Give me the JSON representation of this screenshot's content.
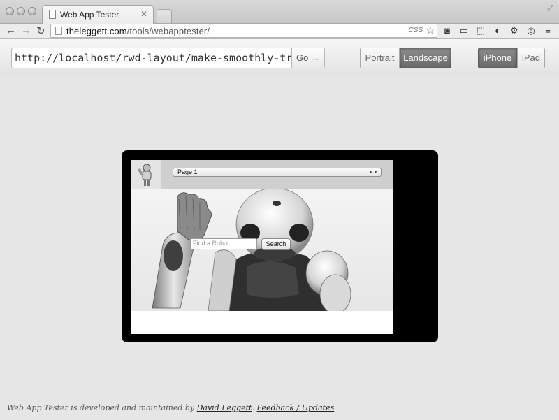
{
  "browser": {
    "tab_title": "Web App Tester",
    "address_domain": "theleggett.com",
    "address_path": "/tools/webapptester/",
    "css_indicator": "CSS"
  },
  "app": {
    "url_value": "http://localhost/rwd-layout/make-smoothly-transitioning",
    "go_label": "Go →",
    "orientation_options": [
      "Portrait",
      "Landscape"
    ],
    "orientation_selected": "Landscape",
    "device_options": [
      "iPhone",
      "iPad"
    ],
    "device_selected": "iPhone"
  },
  "preview": {
    "page_select_value": "Page 1",
    "search_placeholder": "Find a Robot",
    "search_button": "Search"
  },
  "footer": {
    "prefix": "Web App Tester is developed and maintained by ",
    "author": "David Leggett",
    "separator": ". ",
    "feedback": "Feedback / Updates"
  }
}
